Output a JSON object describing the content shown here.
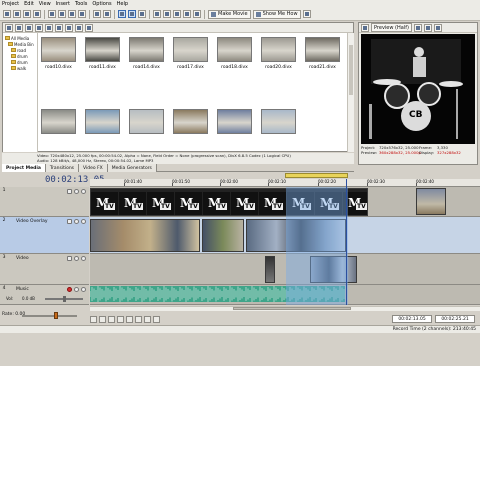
{
  "menu": [
    "Project",
    "Edit",
    "View",
    "Insert",
    "Tools",
    "Options",
    "Help"
  ],
  "toolbar": {
    "make_movie": "Make Movie",
    "show_me_how": "Show Me How"
  },
  "tree": {
    "root": "All Media",
    "child": "Media Bin",
    "items": [
      "road",
      "drum",
      "drum",
      "walk"
    ]
  },
  "media_items": [
    {
      "label": "road10.divx",
      "color": "#9a8f7e"
    },
    {
      "label": "road11.divx",
      "color": "#4a4a44"
    },
    {
      "label": "road14.divx",
      "color": "#7d7a72"
    },
    {
      "label": "road17.divx",
      "color": "#a9a8a0"
    },
    {
      "label": "road18.divx",
      "color": "#8e8a80"
    },
    {
      "label": "road20.divx",
      "color": "#9d9a92"
    },
    {
      "label": "road21.divx",
      "color": "#6f6b62"
    },
    {
      "label": "",
      "color": "#8a8b86"
    },
    {
      "label": "",
      "color": "#7b9ab8"
    },
    {
      "label": "",
      "color": "#b7bdc2"
    },
    {
      "label": "",
      "color": "#8a7a5f"
    },
    {
      "label": "",
      "color": "#6f7f9f"
    },
    {
      "label": "",
      "color": "#a9b8c9"
    }
  ],
  "media_info": {
    "line1": "Video: 720x480x12, 25.000 fps, 00:00:54.02, Alpha = None, Field Order = None (progressive scan), DivX 6.8.5 Codec (1 Logical CPU)",
    "line2": "Audio: 128 kBit/s, 48,000 Hz, Stereo, 00:00:54.02, Lame MP3"
  },
  "doc_tabs": [
    "Project Media",
    "Transitions",
    "Video FX",
    "Media Generators"
  ],
  "preview": {
    "mode": "Preview (Half)",
    "banner": "CB",
    "info": [
      {
        "key": "Project:",
        "val": "720x576x32, 25.000",
        "key2": "Frame:",
        "val2": "3,330"
      },
      {
        "key": "Preview:",
        "val": "360x288x32, 25.000p",
        "key2": "Display:",
        "val2": "327x288x32"
      }
    ]
  },
  "timeline": {
    "timecode": "00:02:13.05",
    "ruler_labels": [
      "00:01:40",
      "00:01:50",
      "00:02:00",
      "00:02:10",
      "00:02:20",
      "00:02:30",
      "00:02:40"
    ],
    "tracks": [
      {
        "num": "1",
        "name": ""
      },
      {
        "num": "2",
        "name": "Video Overlay"
      },
      {
        "num": "3",
        "name": "Video"
      },
      {
        "num": "4",
        "name": "Music",
        "vol_label": "Vol:",
        "vol_value": "0.0 dB"
      }
    ]
  },
  "transport": {
    "rate": "Rate: 0.00",
    "tc_left": "00:02:13.05",
    "tc_right": "00:02:25.21"
  },
  "status": "Record Time (2 channels): 213:40:45"
}
